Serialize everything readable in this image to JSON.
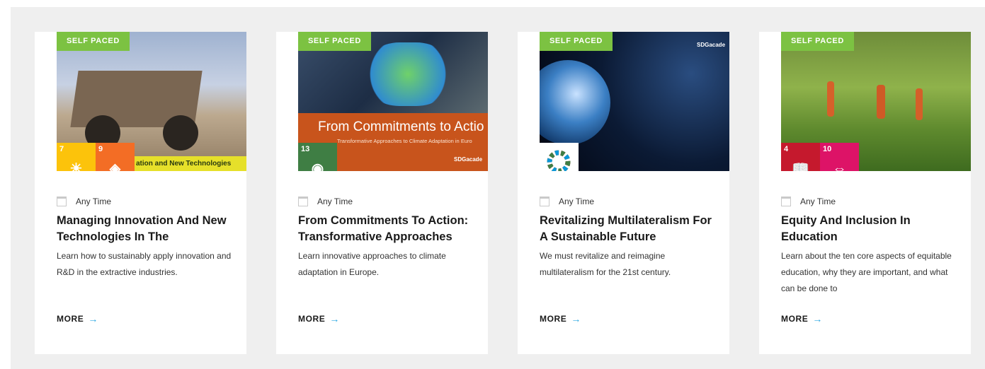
{
  "cards": [
    {
      "badge": "SELF PACED",
      "meta": "Any Time",
      "title": "Managing Innovation And New Technologies In The",
      "description": "Learn how to sustainably apply innovation and R&D in the extractive industries.",
      "more_label": "MORE",
      "image_text": "ation and New Technologies",
      "sdg_tiles": [
        {
          "num": "7",
          "color": "#fcc30b",
          "icon": "sun-icon"
        },
        {
          "num": "9",
          "color": "#f36d25",
          "icon": "cubes-icon"
        }
      ]
    },
    {
      "badge": "SELF PACED",
      "meta": "Any Time",
      "title": "From Commitments To Action: Transformative Approaches",
      "description": "Learn innovative approaches to climate adaptation in Europe.",
      "more_label": "MORE",
      "image_text": "From Commitments to Actio",
      "image_subtext": "Transformative Approaches to Climate Adaptation in Euro",
      "image_logo": "SDGacade",
      "sdg_tiles": [
        {
          "num": "13",
          "color": "#3f7e44",
          "icon": "eye-globe-icon"
        }
      ]
    },
    {
      "badge": "SELF PACED",
      "meta": "Any Time",
      "title": "Revitalizing Multilateralism For A Sustainable Future",
      "description": "We must revitalize and reimagine multilateralism for the 21st century.",
      "more_label": "MORE",
      "image_logo": "SDGacade",
      "sdg_tiles": [
        {
          "num": "",
          "color": "#ffffff",
          "icon": "sdg-wheel-icon"
        }
      ]
    },
    {
      "badge": "SELF PACED",
      "meta": "Any Time",
      "title": "Equity And Inclusion In Education",
      "description": "Learn about the ten core aspects of equitable education, why they are important, and what can be done to",
      "more_label": "MORE",
      "sdg_tiles": [
        {
          "num": "4",
          "color": "#c5192d",
          "icon": "book-icon"
        },
        {
          "num": "10",
          "color": "#dd1367",
          "icon": "equality-icon"
        }
      ]
    }
  ],
  "colors": {
    "badge": "#7cc242",
    "arrow": "#2aa7e1",
    "panel": "#efefef"
  }
}
